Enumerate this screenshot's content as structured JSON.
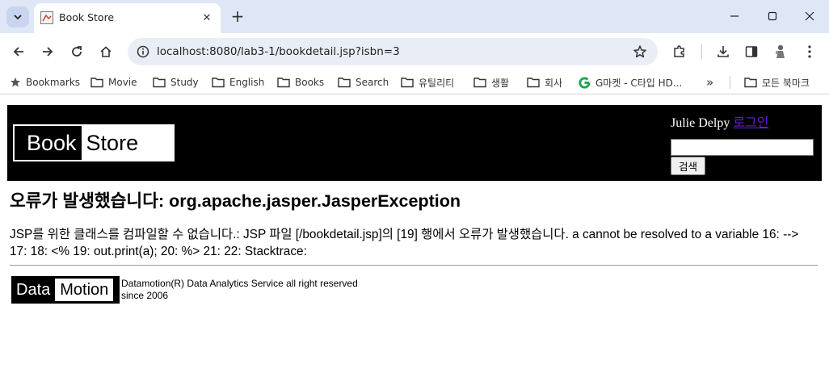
{
  "browser": {
    "tab_title": "Book Store",
    "url": "localhost:8080/lab3-1/bookdetail.jsp?isbn=3",
    "bookmarks": [
      "Bookmarks",
      "Movie",
      "Study",
      "English",
      "Books",
      "Search",
      "유틸리티",
      "생활",
      "회사",
      "G마켓 - C타입 HD...",
      "모든 북마크"
    ]
  },
  "site": {
    "logo_book": "Book",
    "logo_store": "Store",
    "user_name": "Julie Delpy",
    "login_label": "로그인",
    "search_value": "",
    "search_button": "검색"
  },
  "error": {
    "title": "오류가 발생했습니다: org.apache.jasper.JasperException",
    "message": "JSP를 위한 클래스를 컴파일할 수 없습니다.: JSP 파일 [/bookdetail.jsp]의 [19] 행에서 오류가 발생했습니다. a cannot be resolved to a variable 16: --> 17: 18: <% 19: out.print(a); 20: %> 21: 22: Stacktrace:"
  },
  "footer": {
    "logo_data": "Data",
    "logo_motion": "Motion",
    "line1": "Datamotion(R) Data Analytics Service all right reserved",
    "line2": "since 2006"
  }
}
